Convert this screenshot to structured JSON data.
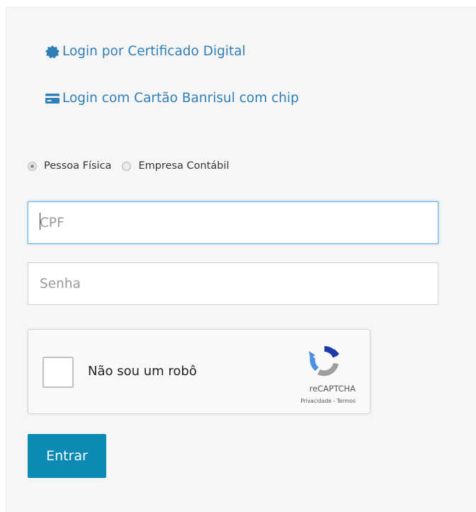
{
  "links": {
    "certificado": {
      "label": "Login por Certificado Digital",
      "icon": "badge-icon"
    },
    "cartao": {
      "label": "Login com Cartão Banrisul com chip",
      "icon": "credit-card-icon"
    }
  },
  "radio": {
    "options": [
      {
        "label": "Pessoa Física",
        "selected": true
      },
      {
        "label": "Empresa Contábil",
        "selected": false
      }
    ]
  },
  "fields": {
    "cpf": {
      "placeholder": "CPF",
      "value": ""
    },
    "senha": {
      "placeholder": "Senha",
      "value": ""
    }
  },
  "captcha": {
    "label": "Não sou um robô",
    "brand": "reCAPTCHA",
    "terms": "Privacidade - Termos"
  },
  "submit": {
    "label": "Entrar"
  },
  "colors": {
    "link": "#2f7eb8",
    "button": "#0b8ab3",
    "focus": "#66afe9"
  }
}
